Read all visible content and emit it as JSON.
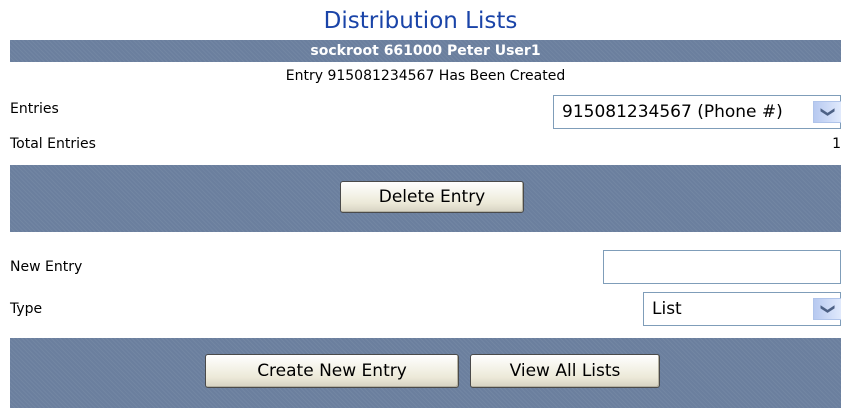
{
  "page": {
    "title": "Distribution Lists"
  },
  "header": {
    "user_line": "sockroot 661000  Peter User1"
  },
  "status": {
    "message": "Entry 915081234567 Has Been Created"
  },
  "entries": {
    "label": "Entries",
    "selected": "915081234567 (Phone #)",
    "total_label": "Total Entries",
    "total_value": "1"
  },
  "actions": {
    "delete_label": "Delete Entry"
  },
  "new_entry": {
    "label": "New Entry",
    "value": "",
    "placeholder": ""
  },
  "type": {
    "label": "Type",
    "selected": "List"
  },
  "footer_actions": {
    "create_label": "Create New Entry",
    "view_all_label": "View All Lists"
  },
  "icons": {
    "dropdown": "chevron-down-icon"
  },
  "colors": {
    "band": "#6b7f9e",
    "title": "#1a44a8"
  }
}
